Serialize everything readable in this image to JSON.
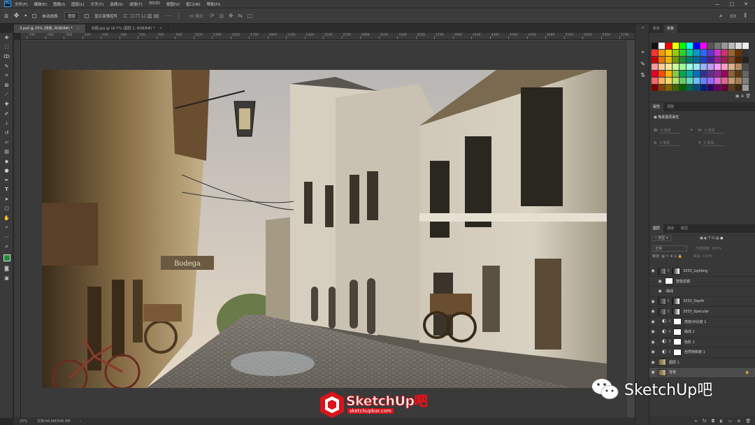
{
  "app": {
    "logo": "Ps",
    "menu": [
      "文件(F)",
      "编辑(E)",
      "图像(I)",
      "图层(L)",
      "文字(Y)",
      "选择(S)",
      "滤镜(T)",
      "3D(D)",
      "视图(V)",
      "窗口(W)",
      "帮助(H)"
    ],
    "window_controls": [
      "—",
      "□",
      "✕"
    ]
  },
  "options_bar": {
    "auto_select_label": "自动选择:",
    "auto_select_value": "图层",
    "transform_label": "显示变换控件",
    "mode_label": "3D 模式:"
  },
  "tabs": [
    {
      "label": "3.psd @ 25% (背景, RGB/8#) *",
      "active": true
    },
    {
      "label": "前图.jpg @ 16.7% (图层 1, RGB/8#) *",
      "active": false
    }
  ],
  "ruler_top": [
    "-700",
    "-500",
    "-300",
    "-100",
    "100",
    "300",
    "500",
    "700",
    "900",
    "1100",
    "1300",
    "1500",
    "1700",
    "1900",
    "2100",
    "2300",
    "2500",
    "2700",
    "2900",
    "3100",
    "3300",
    "3500",
    "3700",
    "3900",
    "4100",
    "4300",
    "4500",
    "4700",
    "4900",
    "5100",
    "5300",
    "5500",
    "5700"
  ],
  "status": {
    "zoom": "25%",
    "doc": "文档:94.9M/540.5M"
  },
  "panels": {
    "swatch_tabs": [
      "颜色",
      "色板"
    ],
    "props_tabs": [
      "属性",
      "调整"
    ],
    "props_title": "像素图层属性",
    "props_fields": {
      "w": "W:",
      "h": "H:",
      "x": "X:",
      "y": "Y:",
      "w_val": "0 像素",
      "h_val": "0 像素",
      "x_val": "0 像素",
      "y_val": "0 像素"
    },
    "layers_tabs": [
      "图层",
      "通道",
      "路径"
    ],
    "layers_filter": "类型",
    "layers_mode": "正常",
    "opacity_label": "不透明度:",
    "opacity_value": "100%",
    "lock_label": "锁定:",
    "fill_label": "填充:",
    "fill_value": "100%",
    "layers": [
      {
        "name": "3333_Lighting",
        "kind": "image-mask"
      },
      {
        "name": "智能滤镜",
        "kind": "filter"
      },
      {
        "name": "曲线",
        "kind": "filter-item"
      },
      {
        "name": "3333_Depth",
        "kind": "image-mask"
      },
      {
        "name": "3333_Specular",
        "kind": "image-mask"
      },
      {
        "name": "亮度/对比度 1",
        "kind": "adjust"
      },
      {
        "name": "曲线 1",
        "kind": "adjust"
      },
      {
        "name": "色阶 1",
        "kind": "adjust"
      },
      {
        "name": "自然饱和度 1",
        "kind": "adjust"
      },
      {
        "name": "图层 1",
        "kind": "image"
      },
      {
        "name": "背景",
        "kind": "background"
      }
    ]
  },
  "canvas_sign": "Bodega",
  "watermark": {
    "wechat_text": "SketchUp吧",
    "logo_text": "SketchUp吧",
    "logo_url": "sketchupbar.com"
  },
  "colors": {
    "accent_red": "#d8141a",
    "ps_blue": "#31a8ff",
    "panel_bg": "#383838"
  }
}
